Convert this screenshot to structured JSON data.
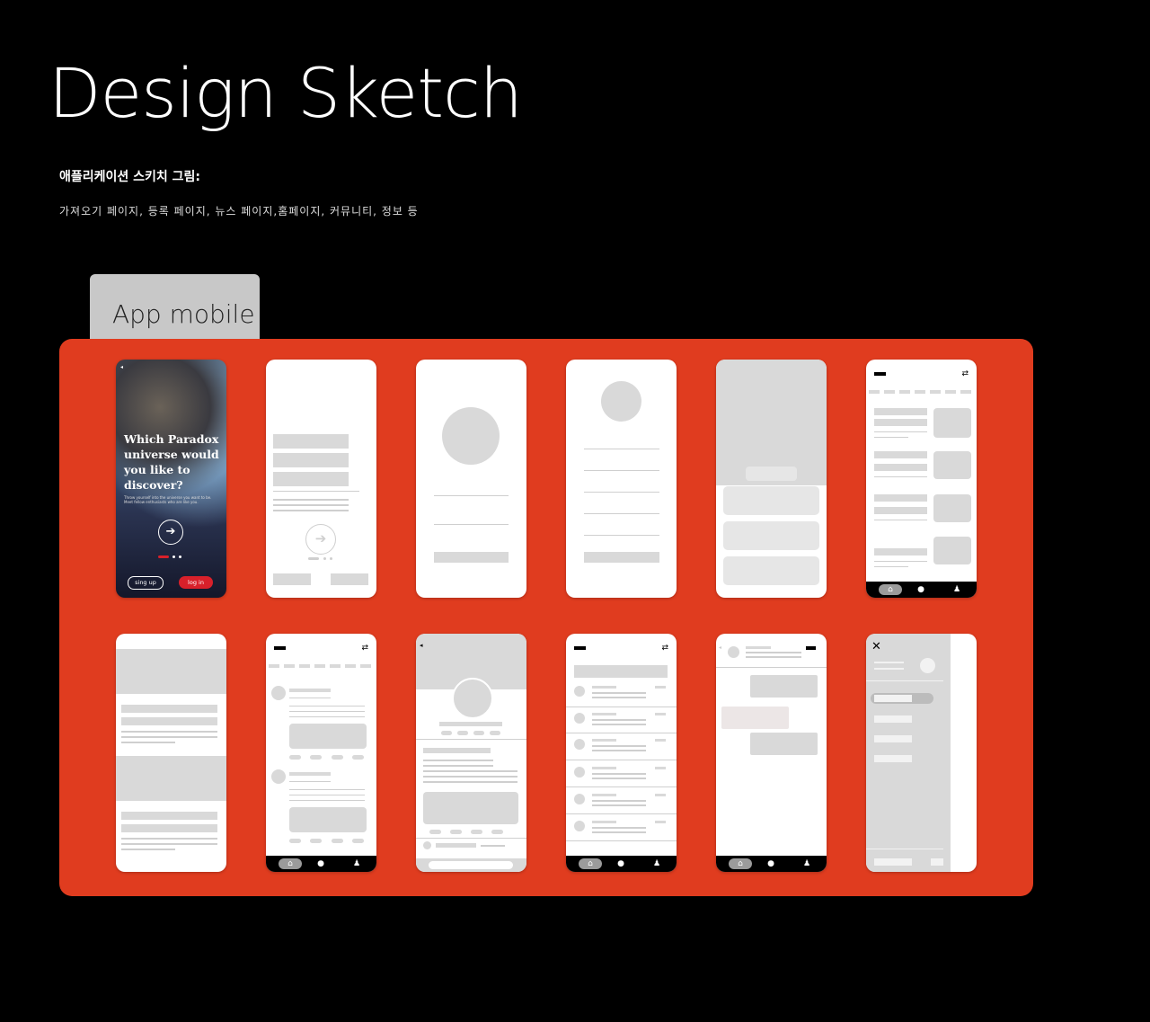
{
  "header": {
    "title": "Design Sketch",
    "subtitle": "애플리케이션 스키치 그림:",
    "description": "가져오기 페이지, 등록 페이지, 뉴스 페이지,홈페이지, 커뮤니티, 정보 등"
  },
  "tab": {
    "label": "App mobile"
  },
  "hero": {
    "title": "Which Paradox universe would you like to discover?",
    "body": "Throw yourself into the universe you want to be. Meet fellow enthusiasts who are like you.",
    "signup_label": "sing up",
    "login_label": "log in"
  },
  "icons": {
    "back": "back-arrow-icon",
    "next": "arrow-right-icon",
    "menu": "filter-icon",
    "home": "home-icon",
    "chat": "chat-icon",
    "people": "people-icon",
    "close": "close-icon"
  },
  "colors": {
    "board": "#e03c1f",
    "accent": "#d8202a",
    "background": "#000000"
  }
}
